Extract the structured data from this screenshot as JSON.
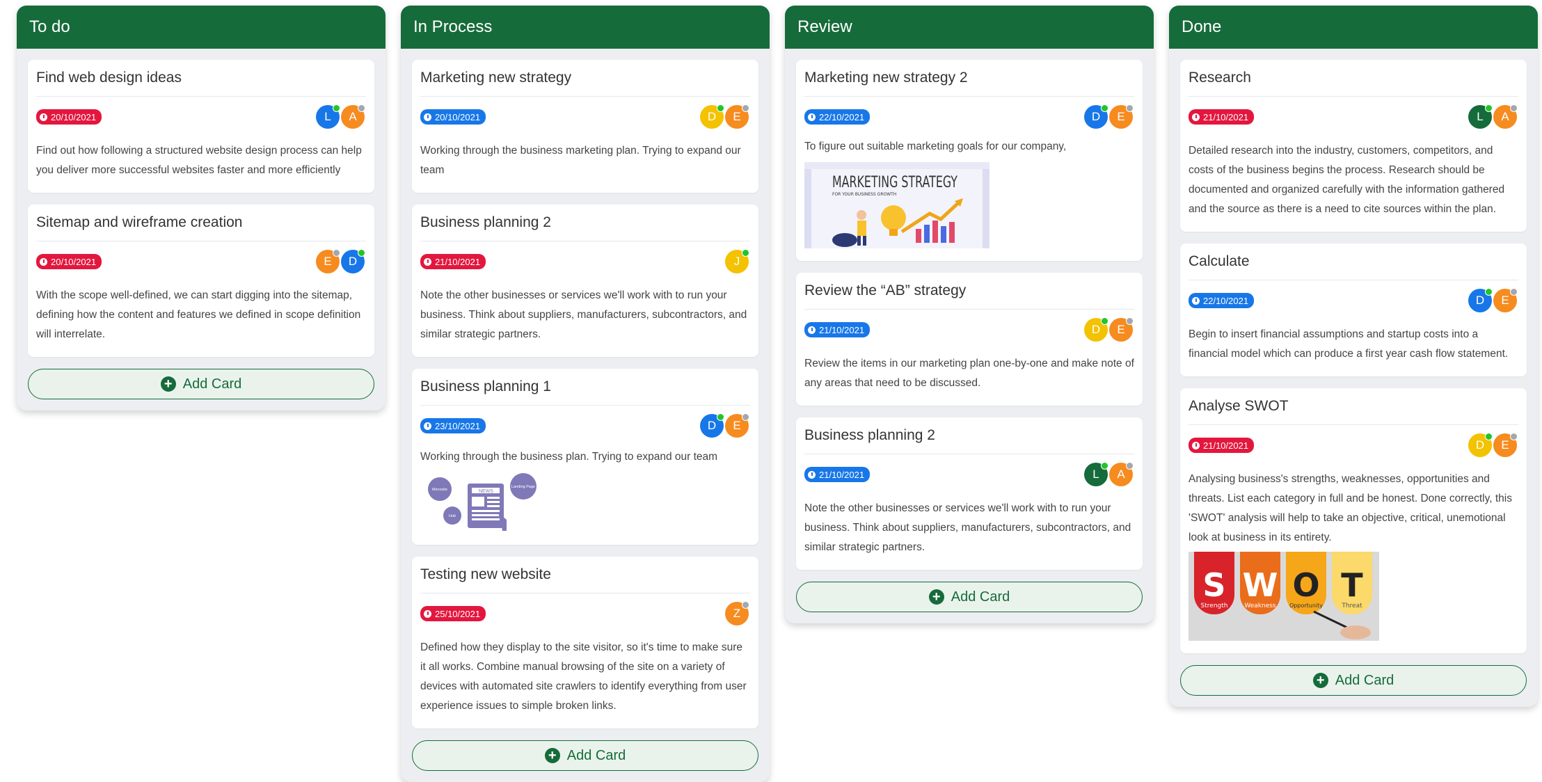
{
  "colors": {
    "header": "#166b3a",
    "date_red": "#e3173e",
    "date_blue": "#1877e8",
    "avatar_blue": "#1877e8",
    "avatar_orange": "#f68b1f",
    "avatar_yellow": "#f3c200",
    "avatar_green": "#166b3a"
  },
  "add_card_label": "Add Card",
  "columns": [
    {
      "title": "To do",
      "cards": [
        {
          "title": "Find web design ideas",
          "date": "20/10/2021",
          "avatars": [
            {
              "letter": "L"
            },
            {
              "letter": "A"
            }
          ],
          "description": "Find out how following a structured website design process can help you deliver more successful websites faster and more efficiently"
        },
        {
          "title": "Sitemap and wireframe creation",
          "date": "20/10/2021",
          "avatars": [
            {
              "letter": "E"
            },
            {
              "letter": "D"
            }
          ],
          "description": "With the scope well-defined, we can start digging into the sitemap, defining how the content and features we defined in scope definition will interrelate."
        }
      ]
    },
    {
      "title": "In Process",
      "cards": [
        {
          "title": "Marketing new strategy",
          "date": "20/10/2021",
          "avatars": [
            {
              "letter": "D"
            },
            {
              "letter": "E"
            }
          ],
          "description": "Working through the business marketing plan. Trying to expand our team"
        },
        {
          "title": "Business planning 2",
          "date": "21/10/2021",
          "avatars": [
            {
              "letter": "J"
            }
          ],
          "description": "Note the other businesses or services we'll work with to run your business. Think about suppliers, manufacturers, subcontractors, and similar strategic partners."
        },
        {
          "title": "Business planning 1",
          "date": "23/10/2021",
          "avatars": [
            {
              "letter": "D"
            },
            {
              "letter": "E"
            }
          ],
          "description": "Working through the business plan. Trying to expand our team",
          "image": {
            "words": [
              "NEWS",
              "Microsite",
              "Landing Page",
              "Hub"
            ]
          }
        },
        {
          "title": "Testing new website",
          "date": "25/10/2021",
          "avatars": [
            {
              "letter": "Z"
            }
          ],
          "description": "Defined how they display to the site visitor, so it's time to make sure it all works. Combine manual browsing of the site on a variety of devices with automated site crawlers to identify everything from user experience issues to simple broken links."
        }
      ]
    },
    {
      "title": "Review",
      "cards": [
        {
          "title": "Marketing new strategy 2",
          "date": "22/10/2021",
          "avatars": [
            {
              "letter": "D"
            },
            {
              "letter": "E"
            }
          ],
          "description": "To figure out suitable marketing goals for our company,",
          "image": {
            "heading": "MARKETING STRATEGY",
            "subheading": "FOR YOUR BUSINESS GROWTH"
          }
        },
        {
          "title": "Review the “AB” strategy",
          "date": "21/10/2021",
          "avatars": [
            {
              "letter": "D"
            },
            {
              "letter": "E"
            }
          ],
          "description": "Review the items in our marketing plan one-by-one and make note of any areas that need to be discussed."
        },
        {
          "title": "Business planning 2",
          "date": "21/10/2021",
          "avatars": [
            {
              "letter": "L"
            },
            {
              "letter": "A"
            }
          ],
          "description": "Note the other businesses or services we'll work with to run your business. Think about suppliers, manufacturers, subcontractors, and similar strategic partners."
        }
      ]
    },
    {
      "title": "Done",
      "cards": [
        {
          "title": "Research",
          "date": "21/10/2021",
          "avatars": [
            {
              "letter": "L"
            },
            {
              "letter": "A"
            }
          ],
          "description": "Detailed research into the industry, customers, competitors, and costs of the business begins the process. Research should be documented and organized carefully with the information gathered and the source as there is a need to cite sources within the plan."
        },
        {
          "title": "Calculate",
          "date": "22/10/2021",
          "avatars": [
            {
              "letter": "D"
            },
            {
              "letter": "E"
            }
          ],
          "description": "Begin to insert financial assumptions and startup costs into a financial model which can produce a first year cash flow statement."
        },
        {
          "title": "Analyse SWOT",
          "date": "21/10/2021",
          "avatars": [
            {
              "letter": "D"
            },
            {
              "letter": "E"
            }
          ],
          "description": "Analysing business's strengths, weaknesses, opportunities and threats. List each category in full and be honest. Done correctly, this 'SWOT' analysis will help to take an objective, critical, unemotional look at business in its entirety.",
          "image": {
            "letters": [
              "S",
              "W",
              "O",
              "T"
            ],
            "labels": [
              "Strength",
              "Weakness",
              "Opportunity",
              "Threat"
            ]
          }
        }
      ]
    }
  ]
}
